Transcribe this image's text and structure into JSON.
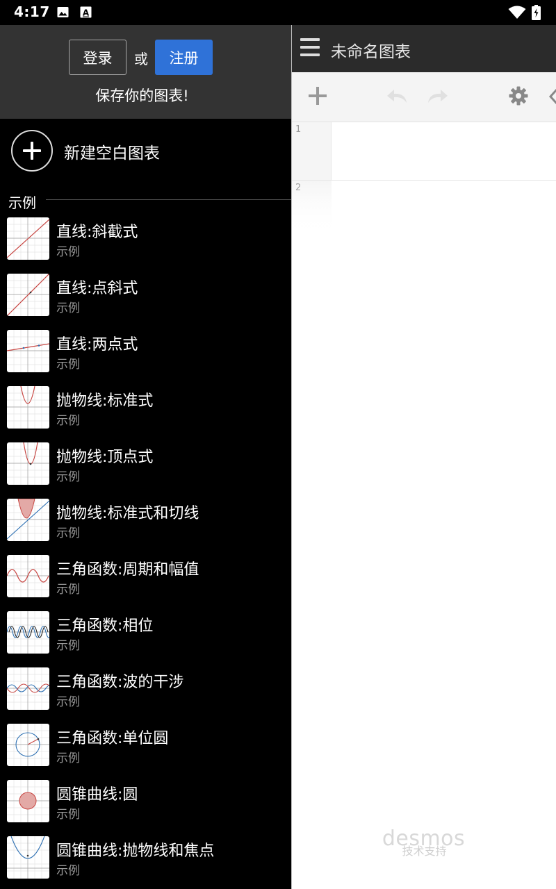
{
  "status_bar": {
    "time": "4:17",
    "icons": [
      "image-icon",
      "font-a-icon",
      "wifi-icon",
      "battery-icon"
    ]
  },
  "drawer": {
    "login_label": "登录",
    "or_label": "或",
    "register_label": "注册",
    "save_hint": "保存你的图表!",
    "new_graph_label": "新建空白图表",
    "section_title": "示例",
    "examples": [
      {
        "title": "直线:斜截式",
        "subtitle": "示例"
      },
      {
        "title": "直线:点斜式",
        "subtitle": "示例"
      },
      {
        "title": "直线:两点式",
        "subtitle": "示例"
      },
      {
        "title": "抛物线:标准式",
        "subtitle": "示例"
      },
      {
        "title": "抛物线:顶点式",
        "subtitle": "示例"
      },
      {
        "title": "抛物线:标准式和切线",
        "subtitle": "示例"
      },
      {
        "title": "三角函数:周期和幅值",
        "subtitle": "示例"
      },
      {
        "title": "三角函数:相位",
        "subtitle": "示例"
      },
      {
        "title": "三角函数:波的干涉",
        "subtitle": "示例"
      },
      {
        "title": "三角函数:单位圆",
        "subtitle": "示例"
      },
      {
        "title": "圆锥曲线:圆",
        "subtitle": "示例"
      },
      {
        "title": "圆锥曲线:抛物线和焦点",
        "subtitle": "示例"
      }
    ]
  },
  "main": {
    "title": "未命名图表",
    "expressions": [
      {
        "index": "1"
      },
      {
        "index": "2"
      }
    ],
    "powered_by": "技术支持",
    "logo_text": "desmos"
  },
  "colors": {
    "register_button": "#2f72d8",
    "drawer_header": "#333333",
    "appbar": "#2b2b2b",
    "toolbar": "#f4f4f4"
  }
}
